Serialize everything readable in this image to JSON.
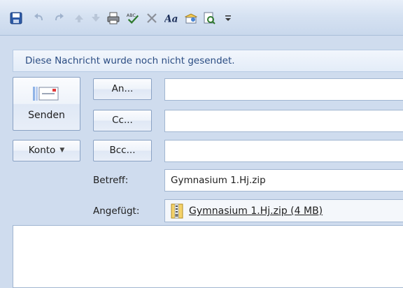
{
  "toolbar": {
    "icons": [
      "save-icon",
      "undo-icon",
      "redo-icon",
      "up-arrow-icon",
      "down-arrow-icon",
      "print-icon",
      "spelling-icon",
      "delete-icon",
      "format-text-icon",
      "address-book-icon",
      "preview-icon",
      "customize-icon"
    ]
  },
  "infobar": {
    "text": "Diese Nachricht wurde noch nicht gesendet."
  },
  "buttons": {
    "send": "Senden",
    "to": "An...",
    "cc": "Cc...",
    "bcc": "Bcc...",
    "account": "Konto"
  },
  "fields": {
    "to": "",
    "cc": "",
    "bcc": "",
    "subject_label": "Betreff:",
    "subject": "Gymnasium 1.Hj.zip",
    "attached_label": "Angefügt:",
    "attachment": "Gymnasium 1.Hj.zip (4 MB)"
  },
  "colors": {
    "background": "#cfdcee",
    "infobar_text": "#2a4c82"
  }
}
